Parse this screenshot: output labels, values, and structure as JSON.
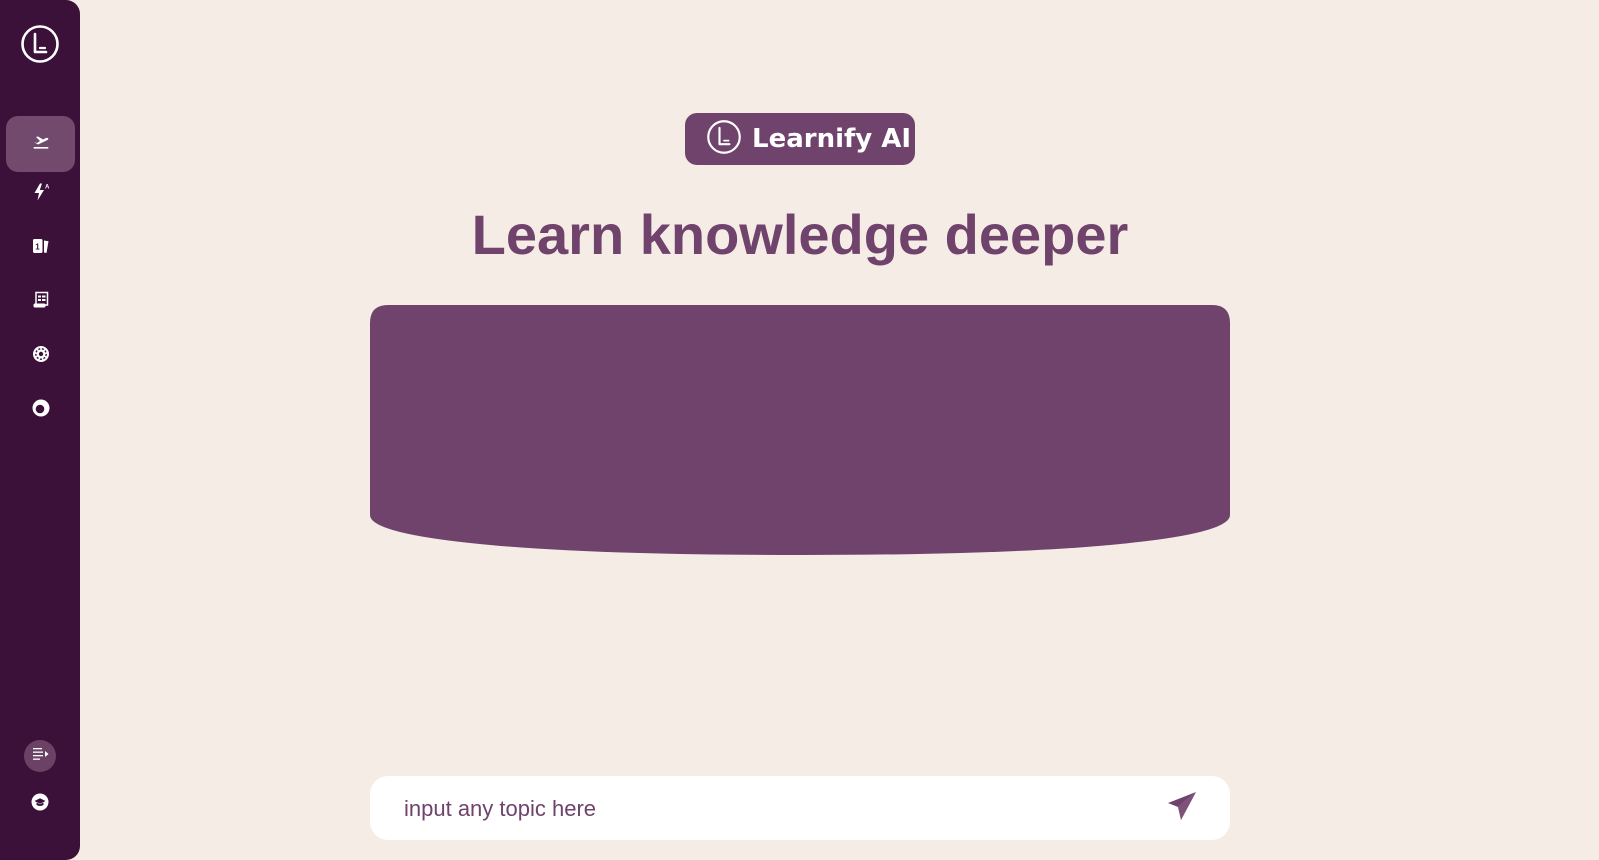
{
  "colors": {
    "page_background": "#f5ece6",
    "sidebar_background": "#3b1139",
    "sidebar_active": "#724a6d",
    "accent": "#6f436b",
    "input_background": "#ffffff"
  },
  "sidebar": {
    "logo_icon": "learnify-logo-icon",
    "items": [
      {
        "icon": "plane-departure-icon",
        "active": true
      },
      {
        "icon": "bolt-auto-icon",
        "active": false
      },
      {
        "icon": "flashcards-icon",
        "active": false
      },
      {
        "icon": "quiz-sheet-icon",
        "active": false
      },
      {
        "icon": "explore-wheel-icon",
        "active": false
      },
      {
        "icon": "progress-ring-icon",
        "active": false
      }
    ],
    "bottom": [
      {
        "icon": "expand-sidebar-icon"
      },
      {
        "icon": "graduation-cap-icon"
      }
    ]
  },
  "brand": {
    "name": "Learnify AI",
    "icon": "learnify-logo-icon"
  },
  "headline": "Learn knowledge deeper",
  "search": {
    "placeholder": "input any topic here",
    "value": "",
    "send_icon": "send-icon"
  }
}
